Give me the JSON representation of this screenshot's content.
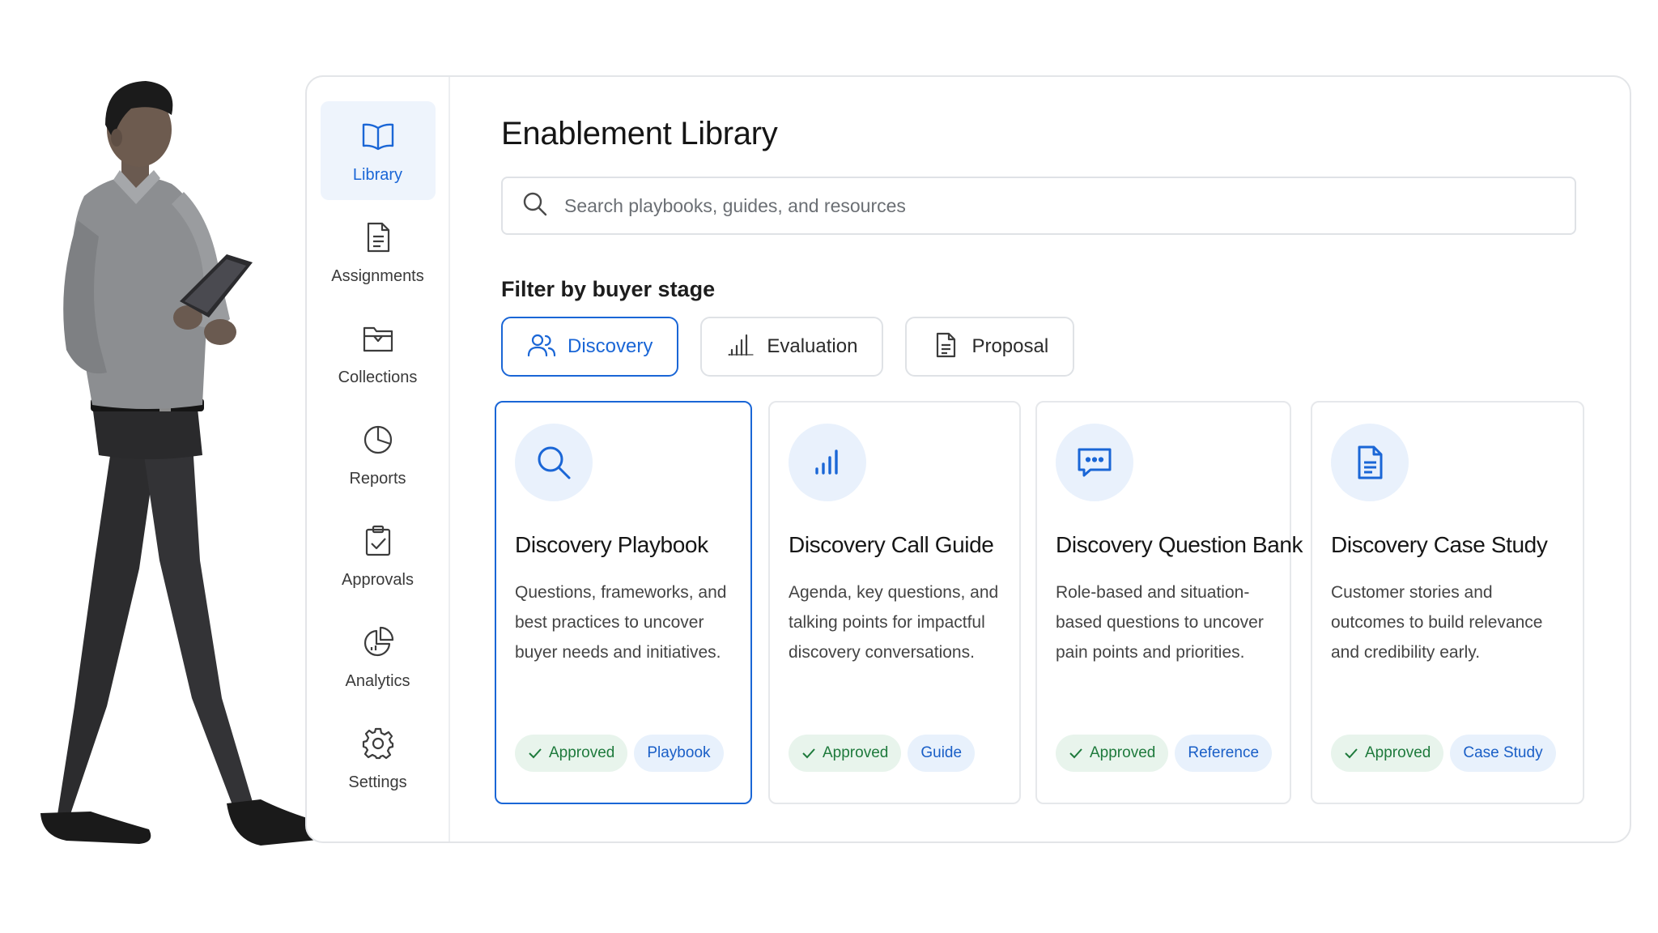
{
  "colors": {
    "accent": "#1a66d6",
    "icon_bg": "#e9f1fc",
    "approved_bg": "#e8f4ec",
    "approved_text": "#1e7a3c",
    "tag_bg": "#e8f1fc"
  },
  "sidebar": {
    "items": [
      {
        "label": "Library",
        "icon": "book-open-icon",
        "active": true
      },
      {
        "label": "Assignments",
        "icon": "document-icon"
      },
      {
        "label": "Collections",
        "icon": "folder-icon"
      },
      {
        "label": "Reports",
        "icon": "pie-chart-icon"
      },
      {
        "label": "Approvals",
        "icon": "clipboard-check-icon"
      },
      {
        "label": "Analytics",
        "icon": "analytics-icon"
      },
      {
        "label": "Settings",
        "icon": "gear-icon"
      }
    ]
  },
  "main": {
    "title": "Enablement Library",
    "search": {
      "placeholder": "Search playbooks, guides, and resources",
      "value": ""
    },
    "filter_heading": "Filter by buyer stage",
    "chips": [
      {
        "label": "Discovery",
        "icon": "users-icon",
        "active": true
      },
      {
        "label": "Evaluation",
        "icon": "bar-chart-icon"
      },
      {
        "label": "Proposal",
        "icon": "document-icon"
      }
    ],
    "cards": [
      {
        "title": "Discovery Playbook",
        "desc_lines": [
          "Questions, frameworks, and",
          "best practices to uncover",
          "buyer needs and initiatives."
        ],
        "status": "Approved",
        "kind": "Playbook",
        "icon": "search-icon",
        "selected": true
      },
      {
        "title": "Discovery Call Guide",
        "desc_lines": [
          "Agenda, key questions, and",
          "talking points for impactful",
          "discovery conversations."
        ],
        "status": "Approved",
        "kind": "Guide",
        "icon": "bar-chart-icon"
      },
      {
        "title": "Discovery Question Bank",
        "desc_lines": [
          "Role-based and situation-",
          "based questions to uncover",
          "pain points and priorities."
        ],
        "status": "Approved",
        "kind": "Reference",
        "icon": "chat-icon"
      },
      {
        "title": "Discovery Case Study",
        "desc_lines": [
          "Customer stories and",
          "outcomes to build relevance",
          "and credibility early."
        ],
        "status": "Approved",
        "kind": "Case Study",
        "icon": "document-icon"
      }
    ]
  }
}
